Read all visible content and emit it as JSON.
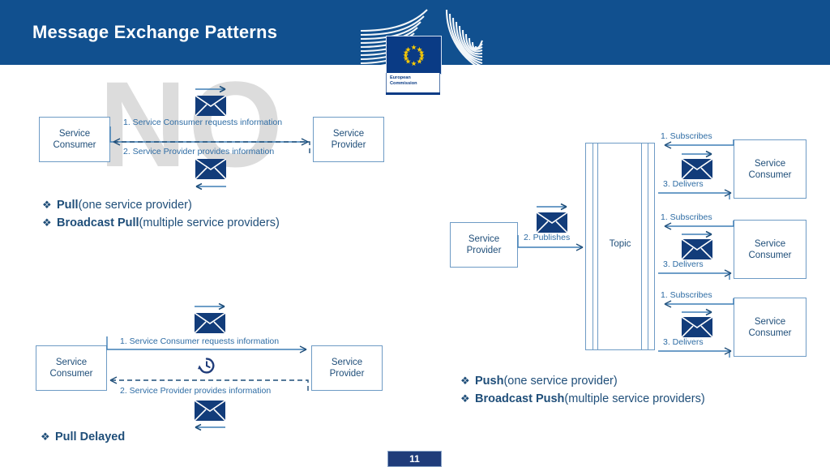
{
  "header": {
    "title": "Message Exchange Patterns",
    "band_color": "#11508F",
    "logo": {
      "name": "european-commission-logo",
      "caption_line1": "European",
      "caption_line2": "Commission"
    }
  },
  "watermark": {
    "text": "NO",
    "color": "#DCDCDC"
  },
  "colors": {
    "accent_blue": "#11508F",
    "text_blue": "#1F4E79",
    "line_blue": "#3E7EB5",
    "envelope_navy": "#123C7A",
    "box_border": "#6E9BC5"
  },
  "pull_diagram": {
    "name": "pull-pattern-diagram",
    "consumer": {
      "line1": "Service",
      "line2": "Consumer"
    },
    "provider": {
      "line1": "Service",
      "line2": "Provider"
    },
    "step1": "1. Service Consumer requests information",
    "step2": "2. Service Provider provides information",
    "envelope_top": "envelope-icon",
    "envelope_bottom": "envelope-icon"
  },
  "pull_bullets": [
    {
      "strong": "Pull",
      "rest": " (one service provider)"
    },
    {
      "strong": "Broadcast Pull",
      "rest": " (multiple service providers)"
    }
  ],
  "pull_delayed_diagram": {
    "name": "pull-delayed-pattern-diagram",
    "consumer": {
      "line1": "Service",
      "line2": "Consumer"
    },
    "provider": {
      "line1": "Service",
      "line2": "Provider"
    },
    "step1": "1. Service Consumer requests information",
    "step2": "2. Service Provider provides information",
    "delay_icon": "clock-history-icon"
  },
  "pull_delayed_bullets": [
    {
      "strong": "Pull Delayed",
      "rest": ""
    }
  ],
  "push_diagram": {
    "name": "push-pattern-diagram",
    "provider": {
      "line1": "Service",
      "line2": "Provider"
    },
    "publish_label": "2. Publishes",
    "topic_label": "Topic",
    "consumers": [
      {
        "line1": "Service",
        "line2": "Consumer",
        "subscribe_label": "1. Subscribes",
        "deliver_label": "3. Delivers"
      },
      {
        "line1": "Service",
        "line2": "Consumer",
        "subscribe_label": "1. Subscribes",
        "deliver_label": "3. Delivers"
      },
      {
        "line1": "Service",
        "line2": "Consumer",
        "subscribe_label": "1. Subscribes",
        "deliver_label": "3. Delivers"
      }
    ]
  },
  "push_bullets": [
    {
      "strong": "Push",
      "rest": " (one service provider)"
    },
    {
      "strong": "Broadcast Push",
      "rest": " (multiple service providers)"
    }
  ],
  "footer": {
    "page_number": "11"
  },
  "bullet_glyph": "❖"
}
